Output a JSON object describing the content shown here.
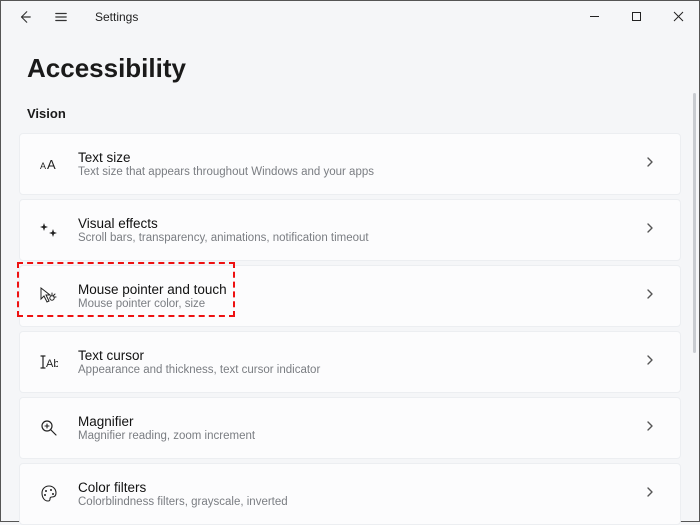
{
  "titlebar": {
    "label": "Settings"
  },
  "page": {
    "title": "Accessibility"
  },
  "section": {
    "vision_label": "Vision"
  },
  "rows": {
    "text_size": {
      "title": "Text size",
      "sub": "Text size that appears throughout Windows and your apps"
    },
    "visual_effects": {
      "title": "Visual effects",
      "sub": "Scroll bars, transparency, animations, notification timeout"
    },
    "mouse_pointer": {
      "title": "Mouse pointer and touch",
      "sub": "Mouse pointer color, size"
    },
    "text_cursor": {
      "title": "Text cursor",
      "sub": "Appearance and thickness, text cursor indicator"
    },
    "magnifier": {
      "title": "Magnifier",
      "sub": "Magnifier reading, zoom increment"
    },
    "color_filters": {
      "title": "Color filters",
      "sub": "Colorblindness filters, grayscale, inverted"
    }
  }
}
